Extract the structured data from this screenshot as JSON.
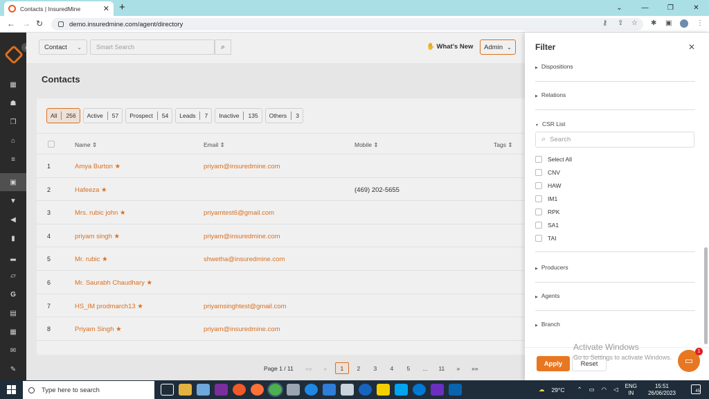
{
  "browser": {
    "tab_title": "Contacts | InsuredMine",
    "url": "demo.insuredmine.com/agent/directory"
  },
  "header": {
    "contact_type": "Contact",
    "search_placeholder": "Smart Search",
    "whats_new": "What's New",
    "user_menu": "Admin"
  },
  "page": {
    "title": "Contacts"
  },
  "filters": [
    {
      "label": "All",
      "count": "256"
    },
    {
      "label": "Active",
      "count": "57"
    },
    {
      "label": "Prospect",
      "count": "54"
    },
    {
      "label": "Leads",
      "count": "7"
    },
    {
      "label": "Inactive",
      "count": "135"
    },
    {
      "label": "Others",
      "count": "3"
    }
  ],
  "table": {
    "columns": [
      "Name",
      "Email",
      "Mobile",
      "Tags"
    ],
    "rows": [
      {
        "n": "1",
        "name": "Amya Burton",
        "email": "priyam@insuredmine.com",
        "mobile": ""
      },
      {
        "n": "2",
        "name": "Hafeeza",
        "email": "",
        "mobile": "(469) 202-5655"
      },
      {
        "n": "3",
        "name": "Mrs. rubic john",
        "email": "priyamtest6@gmail.com",
        "mobile": ""
      },
      {
        "n": "4",
        "name": "priyam singh",
        "email": "priyam@insuredmine.com",
        "mobile": ""
      },
      {
        "n": "5",
        "name": "Mr. rubic",
        "email": "shwetha@insuredmine.com",
        "mobile": ""
      },
      {
        "n": "6",
        "name": "Mr. Saurabh Chaudhary",
        "email": "",
        "mobile": ""
      },
      {
        "n": "7",
        "name": "HS_IM prodmarch13",
        "email": "priyamsinghtest@gmail.com",
        "mobile": ""
      },
      {
        "n": "8",
        "name": "Priyam Singh",
        "email": "priyam@insuredmine.com",
        "mobile": ""
      }
    ]
  },
  "pagination": {
    "label": "Page 1 / 11",
    "first": "««",
    "prev": "«",
    "pages": [
      "1",
      "2",
      "3",
      "4",
      "5",
      "...",
      "11"
    ],
    "next": "»",
    "last": "»»"
  },
  "filter_panel": {
    "title": "Filter",
    "sections": {
      "dispositions": "Dispositions",
      "relations": "Relations",
      "csr_list": "CSR List",
      "producers": "Producers",
      "agents": "Agents",
      "branch": "Branch"
    },
    "csr_search_placeholder": "Search",
    "csr_options": [
      "Select All",
      "CNV",
      "HAW",
      "IM1",
      "RPK",
      "SA1",
      "TAI"
    ],
    "apply": "Apply",
    "reset": "Reset"
  },
  "watermark": {
    "title": "Activate Windows",
    "subtitle": "Go to Settings to activate Windows."
  },
  "chat_badge": "1",
  "taskbar": {
    "search_placeholder": "Type here to search",
    "weather": "29°C",
    "lang_top": "ENG",
    "lang_bottom": "IN",
    "time": "15:51",
    "date": "26/06/2023",
    "notifications": "45"
  },
  "colors": {
    "accent": "#e87722",
    "sidebar": "#2d2d2d",
    "taskbar": "#1f2d3a"
  }
}
